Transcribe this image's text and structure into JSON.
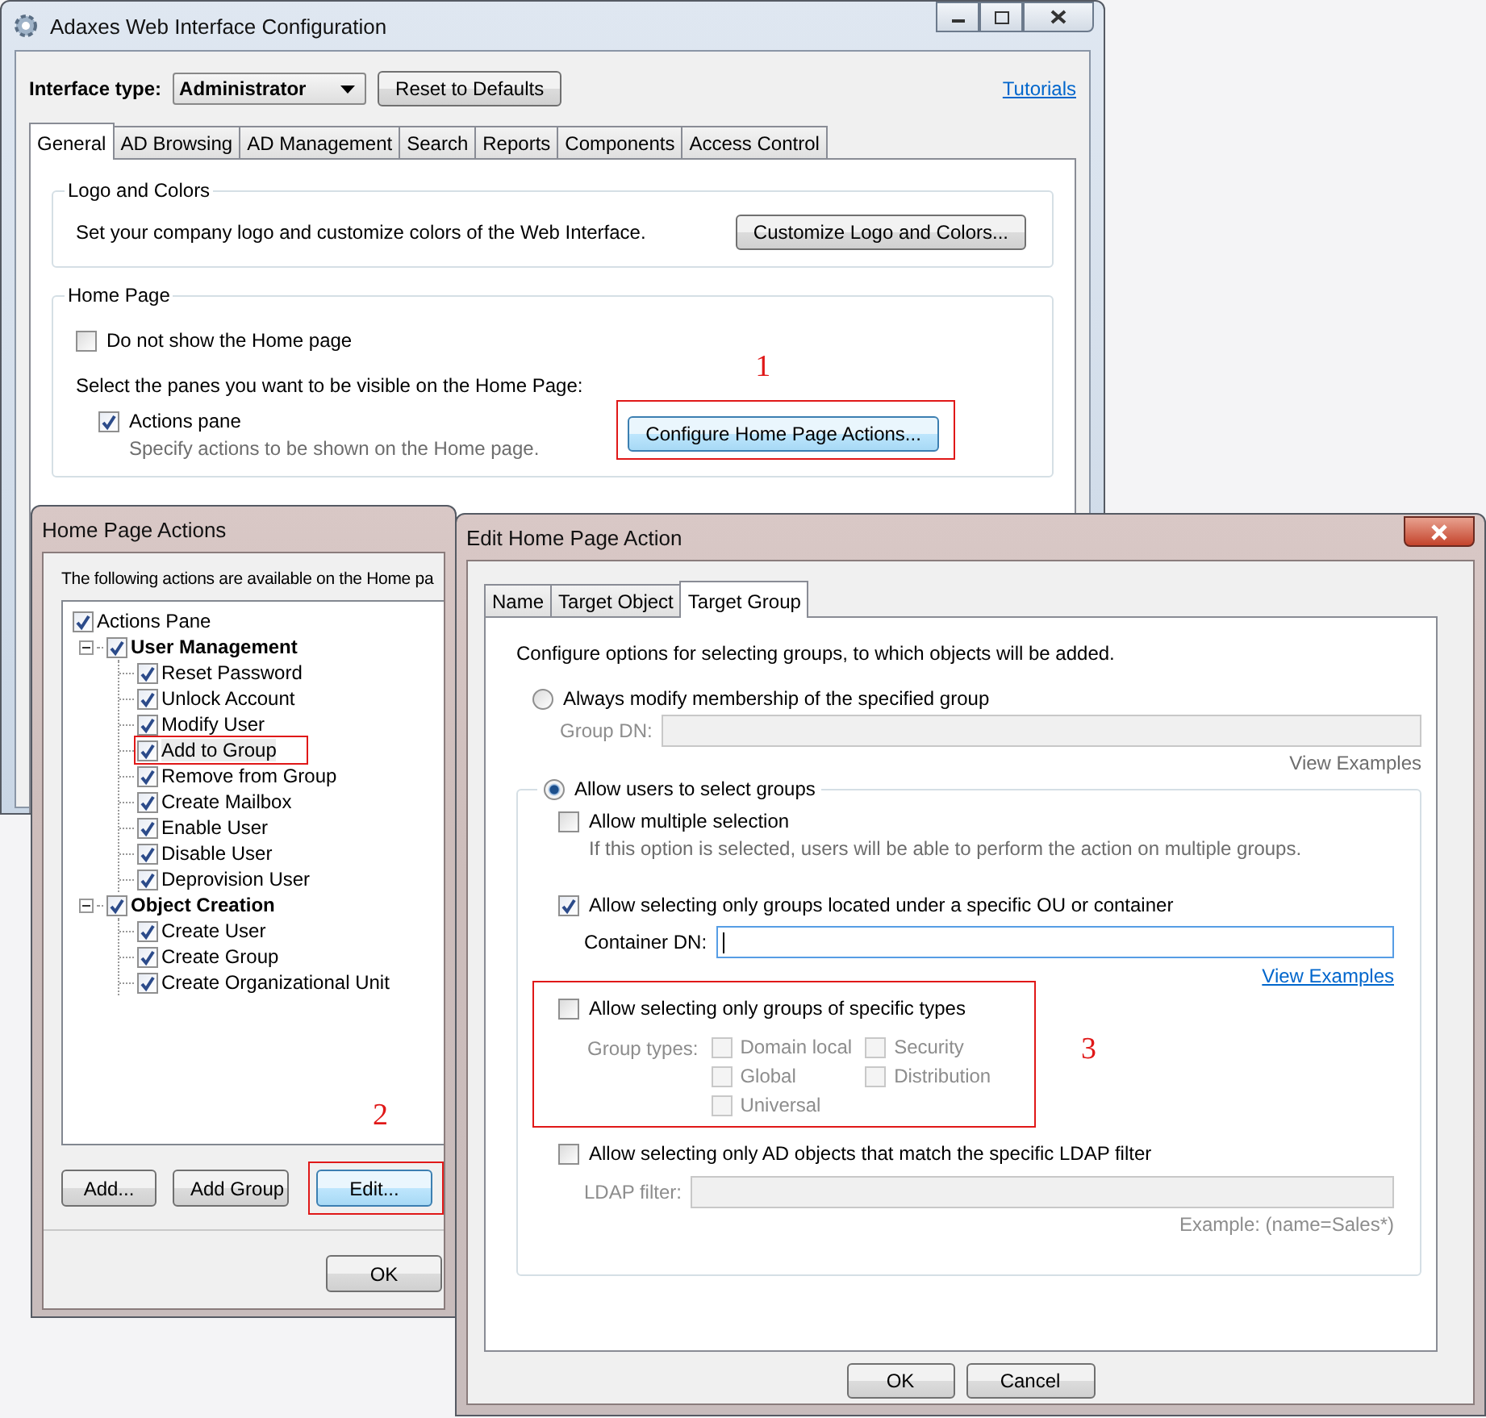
{
  "main_window": {
    "title": "Adaxes Web Interface Configuration",
    "interface_type_label": "Interface type:",
    "interface_type": "Administrator",
    "reset_button": "Reset to Defaults",
    "tutorials_link": "Tutorials",
    "tabs": [
      {
        "label": "General",
        "selected": true
      },
      {
        "label": "AD Browsing",
        "selected": false
      },
      {
        "label": "AD Management",
        "selected": false
      },
      {
        "label": "Search",
        "selected": false
      },
      {
        "label": "Reports",
        "selected": false
      },
      {
        "label": "Components",
        "selected": false
      },
      {
        "label": "Access Control",
        "selected": false
      }
    ],
    "logo_group": {
      "title": "Logo and Colors",
      "text": "Set your company logo and customize colors of the Web Interface.",
      "button": "Customize Logo and Colors..."
    },
    "home_group": {
      "title": "Home Page",
      "hide_home": {
        "label": "Do not show the Home page",
        "checked": false
      },
      "panes_prompt": "Select the panes you want to be visible on the Home Page:",
      "actions_pane": {
        "label": "Actions pane",
        "checked": true,
        "hint": "Specify actions to be shown on the Home page."
      },
      "configure_button": {
        "label": "Configure Home Page Actions...",
        "annotation": "1"
      }
    }
  },
  "actions_dialog": {
    "title": "Home Page Actions",
    "intro": "The following actions are available on the Home pa",
    "tree": [
      {
        "label": "Actions Pane",
        "checked": true,
        "children": [
          {
            "label": "User Management",
            "checked": true,
            "expanded": true,
            "children": [
              {
                "label": "Reset Password",
                "checked": true,
                "highlighted": false
              },
              {
                "label": "Unlock Account",
                "checked": true,
                "highlighted": false
              },
              {
                "label": "Modify User",
                "checked": true,
                "highlighted": false
              },
              {
                "label": "Add to Group",
                "checked": true,
                "highlighted": true
              },
              {
                "label": "Remove from Group",
                "checked": true,
                "highlighted": false
              },
              {
                "label": "Create Mailbox",
                "checked": true,
                "highlighted": false
              },
              {
                "label": "Enable User",
                "checked": true,
                "highlighted": false
              },
              {
                "label": "Disable User",
                "checked": true,
                "highlighted": false
              },
              {
                "label": "Deprovision User",
                "checked": true,
                "highlighted": false
              }
            ]
          },
          {
            "label": "Object Creation",
            "checked": true,
            "expanded": true,
            "children": [
              {
                "label": "Create User",
                "checked": true,
                "highlighted": false
              },
              {
                "label": "Create Group",
                "checked": true,
                "highlighted": false
              },
              {
                "label": "Create Organizational Unit",
                "checked": true,
                "highlighted": false
              }
            ]
          }
        ]
      }
    ],
    "buttons": [
      {
        "label": "Add..."
      },
      {
        "label": "Add Group"
      },
      {
        "label": "Edit...",
        "annotation": "2"
      }
    ],
    "ok_button": "OK"
  },
  "edit_dialog": {
    "title": "Edit Home Page Action",
    "tabs": [
      {
        "label": "Name",
        "selected": false
      },
      {
        "label": "Target Object",
        "selected": false
      },
      {
        "label": "Target Group",
        "selected": true
      }
    ],
    "intro": "Configure options for selecting groups, to which objects will be added.",
    "modes": [
      {
        "label": "Always modify membership of the specified group",
        "selected": false
      },
      {
        "label": "Allow users to select groups",
        "selected": true
      }
    ],
    "group_dn": {
      "label": "Group DN:",
      "disabled": true
    },
    "group_dn_examples": {
      "label": "View Examples",
      "disabled": true
    },
    "multiple": {
      "label": "Allow multiple selection",
      "checked": false,
      "hint": "If this option is selected, users will be able to perform the action on multiple groups."
    },
    "ou": {
      "label": "Allow selecting only groups located under a specific OU or container",
      "checked": true
    },
    "container_dn": {
      "label": "Container DN:",
      "focused": true
    },
    "container_examples": {
      "label": "View Examples",
      "disabled": false
    },
    "types": {
      "label": "Allow selecting only groups of specific types",
      "checked": false,
      "annotation": "3",
      "types_label": "Group types:",
      "scopes": [
        {
          "label": "Domain local",
          "checked": false
        },
        {
          "label": "Global",
          "checked": false
        },
        {
          "label": "Universal",
          "checked": false
        }
      ],
      "categories": [
        {
          "label": "Security",
          "checked": false
        },
        {
          "label": "Distribution",
          "checked": false
        }
      ]
    },
    "ldap": {
      "label": "Allow selecting only AD objects that match the specific LDAP filter",
      "checked": false,
      "field_label": "LDAP filter:",
      "example": "Example: (name=Sales*)"
    },
    "buttons": [
      {
        "label": "OK"
      },
      {
        "label": "Cancel"
      }
    ]
  }
}
